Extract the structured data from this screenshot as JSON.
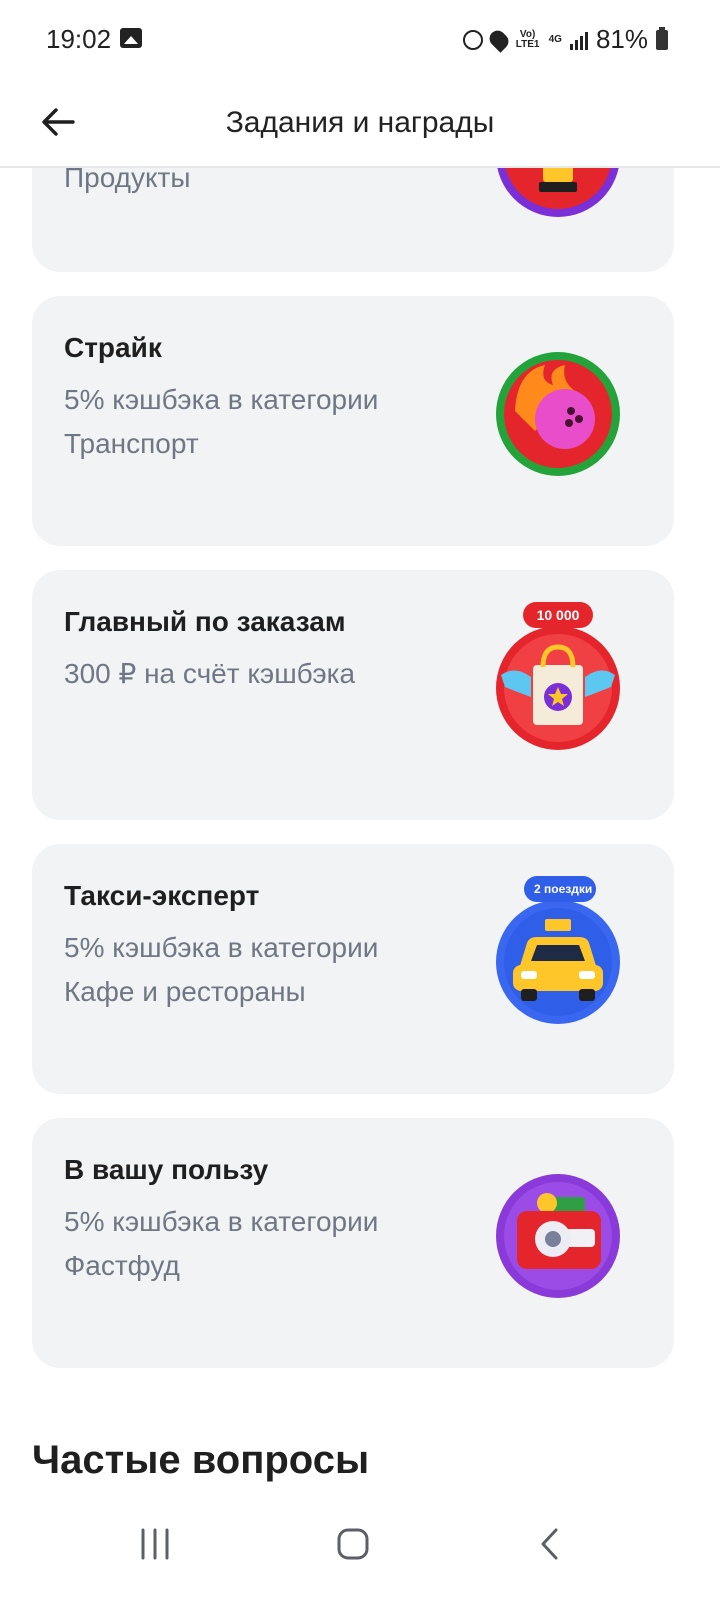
{
  "status_bar": {
    "time": "19:02",
    "network": "Vo) LTE1",
    "network_type": "4G",
    "battery": "81%"
  },
  "header": {
    "title": "Задания и награды",
    "back_icon": "arrow-left-icon"
  },
  "cards": [
    {
      "title": "",
      "desc": "Продукты",
      "badge_icon": "trophy-badge-icon"
    },
    {
      "title": "Страйк",
      "desc": "5% кэшбэка в категории Транспорт",
      "badge_icon": "bowling-ball-badge-icon"
    },
    {
      "title": "Главный по заказам",
      "desc": "300 ₽ на счёт кэшбэка",
      "badge_label": "10 000",
      "badge_icon": "shopping-bag-badge-icon"
    },
    {
      "title": "Такси-эксперт",
      "desc": "5% кэшбэка в категории Кафе и рестораны",
      "badge_label": "2 поездки",
      "badge_icon": "taxi-badge-icon"
    },
    {
      "title": "В вашу пользу",
      "desc": "5% кэшбэка в категории Фастфуд",
      "badge_icon": "wallet-safe-badge-icon"
    }
  ],
  "faq": {
    "heading": "Частые вопросы"
  },
  "colors": {
    "card_bg": "#f2f3f5",
    "muted_text": "#707784",
    "badge_red": "#e4262c",
    "badge_green": "#24a33a",
    "badge_blue": "#2f5ee8",
    "badge_purple": "#8a3ad8"
  }
}
